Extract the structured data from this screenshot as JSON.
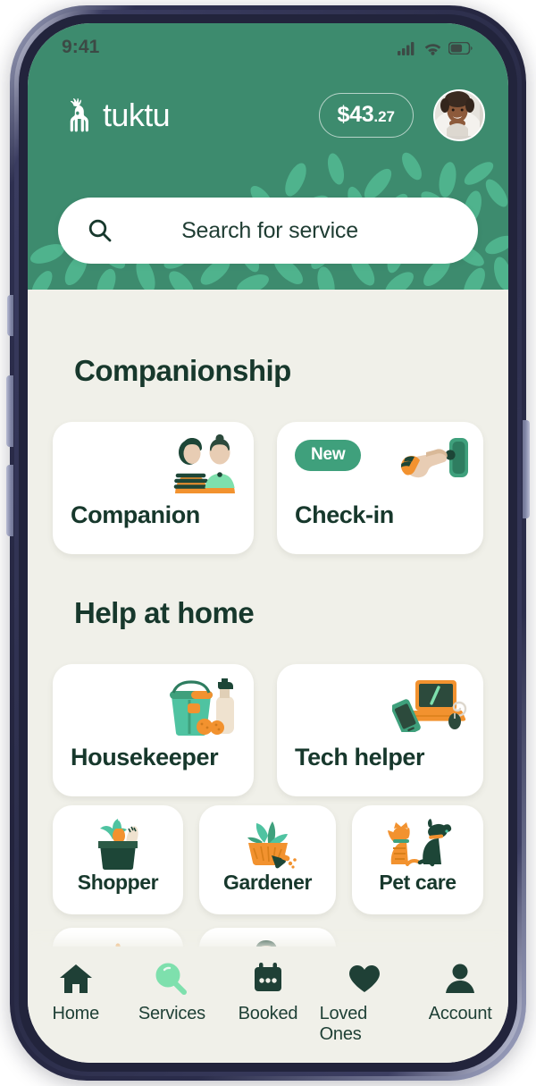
{
  "status_bar": {
    "time": "9:41",
    "icons": [
      "cellular-signal-icon",
      "wifi-icon",
      "battery-icon"
    ]
  },
  "header": {
    "brand_name": "tuktu",
    "brand_logo_icon": "caribou-logo-icon",
    "balance_amount": "$43",
    "balance_cents": ".27",
    "avatar_icon": "user-avatar",
    "background_color": "#3d8b6e",
    "leaf_color": "#4fb38d"
  },
  "search": {
    "icon": "search-icon",
    "placeholder": "Search for service"
  },
  "sections": [
    {
      "title": "Companionship",
      "cards": [
        {
          "label": "Companion",
          "icon": "two-people-icon",
          "badge": null
        },
        {
          "label": "Check-in",
          "icon": "hand-pressing-button-icon",
          "badge": "New"
        }
      ]
    },
    {
      "title": "Help at home",
      "cards": [
        {
          "label": "Housekeeper",
          "icon": "cleaning-bucket-icon",
          "badge": null
        },
        {
          "label": "Tech helper",
          "icon": "laptop-phone-mouse-icon",
          "badge": null
        },
        {
          "label": "Shopper",
          "icon": "grocery-bag-icon",
          "badge": null
        },
        {
          "label": "Gardener",
          "icon": "potted-plant-trowel-icon",
          "badge": null
        },
        {
          "label": "Pet care",
          "icon": "cat-and-dog-icon",
          "badge": null
        },
        {
          "label": "",
          "icon": "cooking-pot-icon",
          "badge": null
        },
        {
          "label": "",
          "icon": "handyman-person-icon",
          "badge": null
        }
      ]
    }
  ],
  "bottom_nav": {
    "active": "Services",
    "items": [
      {
        "label": "Home",
        "icon": "home-icon",
        "active": false
      },
      {
        "label": "Services",
        "icon": "search-magnifier-icon",
        "active": true
      },
      {
        "label": "Booked",
        "icon": "calendar-icon",
        "active": false
      },
      {
        "label": "Loved Ones",
        "icon": "heart-icon",
        "active": false
      },
      {
        "label": "Account",
        "icon": "person-icon",
        "active": false
      }
    ]
  },
  "colors": {
    "brand_green": "#3d8b6e",
    "accent_green": "#3fa07c",
    "active_nav_green": "#7ee0ad",
    "dark_text": "#17382c",
    "page_background": "#f0f0e9",
    "card_white": "#ffffff",
    "orange": "#f2922f"
  }
}
